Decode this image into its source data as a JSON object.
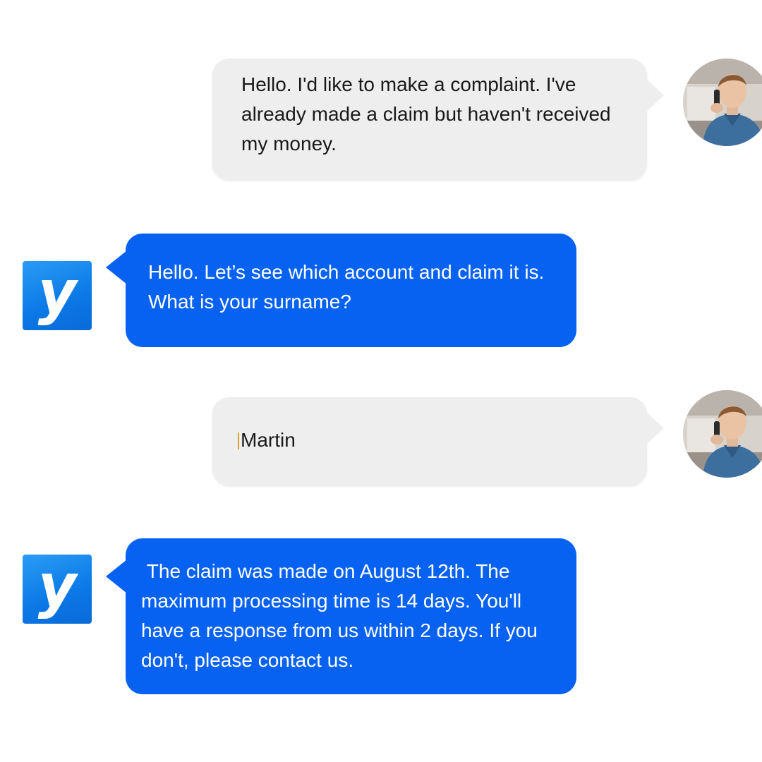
{
  "messages": [
    {
      "sender": "user",
      "text": "Hello. I'd like to make a complaint. I've already made a claim but haven't received my money."
    },
    {
      "sender": "bot",
      "text": "Hello. Let’s see which account and claim it is. What is your surname?"
    },
    {
      "sender": "user",
      "text": "Martin"
    },
    {
      "sender": "bot",
      "text": " The claim was made on August 12th. The maximum processing time is 14 days. You'll have a response from us within 2 days. If you don't, please contact us."
    }
  ],
  "bot_logo": {
    "icon": "brand-y-logo",
    "letter": "y",
    "color": "#0b78e6"
  },
  "user_avatar": {
    "icon": "user-photo-avatar"
  },
  "colors": {
    "user_bubble": "#eeeeee",
    "bot_bubble": "#0762f2",
    "user_text": "#1a1a1a",
    "bot_text": "#ffffff",
    "caret": "#e0a030"
  }
}
